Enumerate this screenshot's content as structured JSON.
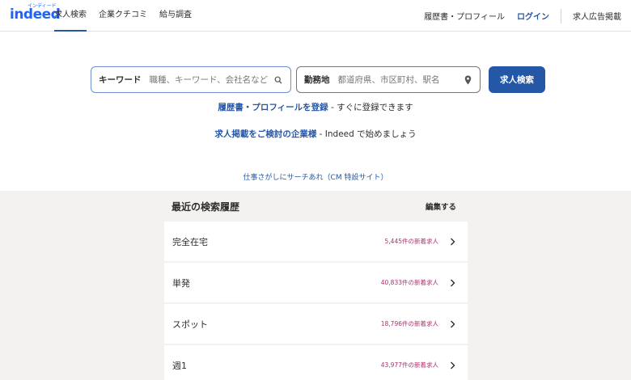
{
  "header": {
    "logo_text": "indeed",
    "logo_kana": "インディード",
    "nav_left": [
      "求人検索",
      "企業クチコミ",
      "給与調査"
    ],
    "resume_link": "履歴書・プロフィール",
    "login_link": "ログイン",
    "employer_link": "求人広告掲載"
  },
  "search": {
    "what_label": "キーワード",
    "what_placeholder": "職種、キーワード、会社名など",
    "where_label": "勤務地",
    "where_placeholder": "都道府県、市区町村、駅名",
    "button_label": "求人検索"
  },
  "promo": {
    "resume_link": "履歴書・プロフィールを登録",
    "resume_rest": " - すぐに登録できます",
    "employer_link": "求人掲載をご検討の企業様",
    "employer_rest": " - Indeed で始めましょう"
  },
  "cm_link": "仕事さがしにサーチあれ（CM 特設サイト）",
  "history": {
    "title": "最近の検索履歴",
    "edit_label": "編集する",
    "items": [
      {
        "term": "完全在宅",
        "count": "5,445件の新着求人"
      },
      {
        "term": "単発",
        "count": "40,833件の新着求人"
      },
      {
        "term": "スポット",
        "count": "18,796件の新着求人"
      },
      {
        "term": "週1",
        "count": "43,977件の新着求人"
      }
    ]
  },
  "colors": {
    "brand_blue": "#2557a7",
    "logo_blue": "#2164f3",
    "count_magenta": "#a8326d"
  }
}
